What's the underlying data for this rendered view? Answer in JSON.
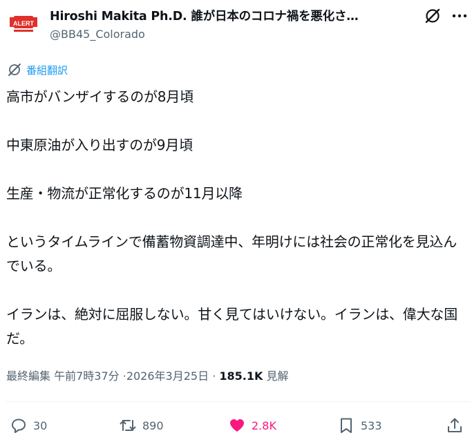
{
  "author": {
    "name": "Hiroshi Makita Ph.D. 誰が日本のコロナ禍を悪化さ…",
    "handle": "@BB45_Colorado",
    "avatar_label": "ALERT"
  },
  "header_icons": [
    "grok-icon",
    "more-icon"
  ],
  "translate_label": "番組翻訳",
  "tweet_text": "高市がバンザイするのが8月頃\n\n中東原油が入り出すのが9月頃\n\n生産・物流が正常化するのが11月以降\n\nというタイムラインで備蓄物資調達中、年明けには社会の正常化を見込んでいる。\n\nイランは、絶対に屈服しない。甘く見てはいけない。イランは、偉大な国だ。",
  "meta": {
    "edited_label": "最終編集 午前7時37分",
    "date": "·2026年3月25日",
    "separator": "·",
    "views_count": "185.1K",
    "views_label": "見解"
  },
  "actions": {
    "replies": "30",
    "reposts": "890",
    "likes": "2.8K",
    "bookmarks": "533"
  },
  "colors": {
    "accent": "#1d9bf0",
    "like": "#f91880",
    "secondary_text": "#536471",
    "avatar_red": "#e0302a"
  }
}
